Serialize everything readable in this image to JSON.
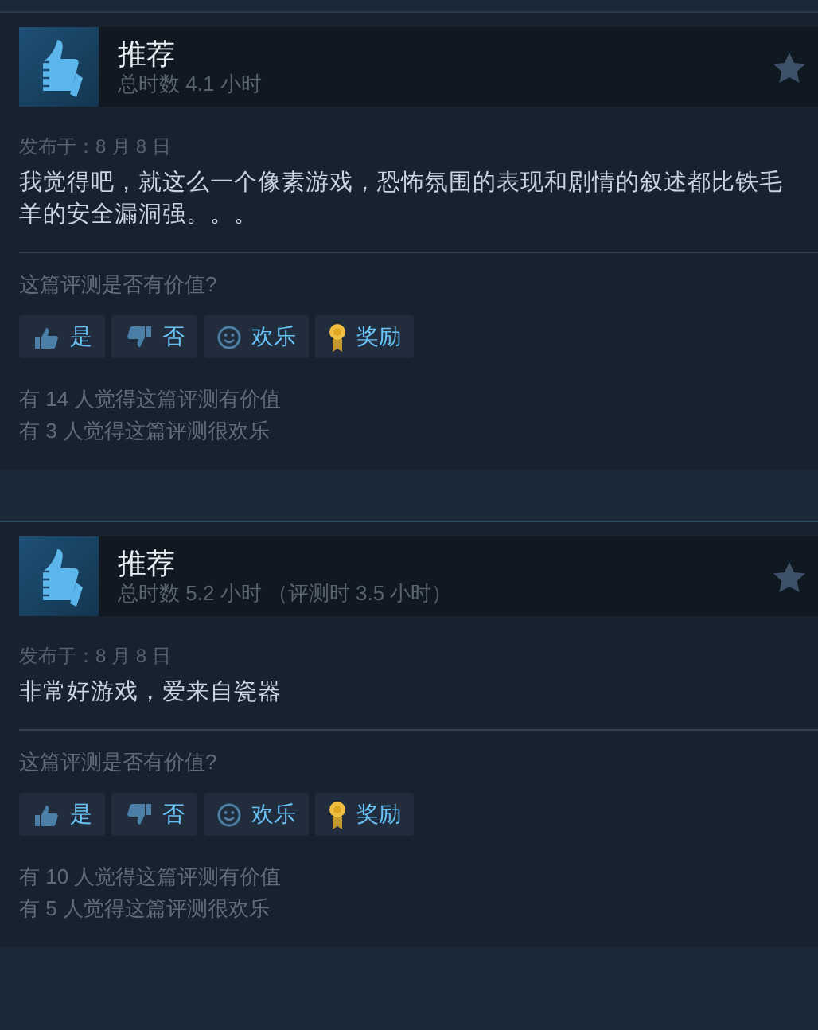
{
  "reviews": [
    {
      "title": "推荐",
      "hours": "总时数 4.1 小时",
      "posted": "发布于：8 月 8 日",
      "body": "我觉得吧，就这么一个像素游戏，恐怖氛围的表现和剧情的叙述都比铁毛羊的安全漏洞强。。。",
      "question": "这篇评测是否有价值?",
      "buttons": [
        {
          "kind": "yes",
          "label": "是"
        },
        {
          "kind": "no",
          "label": "否"
        },
        {
          "kind": "funny",
          "label": "欢乐"
        },
        {
          "kind": "award",
          "label": "奖励"
        }
      ],
      "counts": [
        "有 14 人觉得这篇评测有价值",
        "有 3 人觉得这篇评测很欢乐"
      ]
    },
    {
      "title": "推荐",
      "hours": "总时数 5.2 小时 （评测时 3.5 小时）",
      "posted": "发布于：8 月 8 日",
      "body": "非常好游戏，爱来自瓷器",
      "question": "这篇评测是否有价值?",
      "buttons": [
        {
          "kind": "yes",
          "label": "是"
        },
        {
          "kind": "no",
          "label": "否"
        },
        {
          "kind": "funny",
          "label": "欢乐"
        },
        {
          "kind": "award",
          "label": "奖励"
        }
      ],
      "counts": [
        "有 10 人觉得这篇评测有价值",
        "有 5 人觉得这篇评测很欢乐"
      ]
    }
  ]
}
